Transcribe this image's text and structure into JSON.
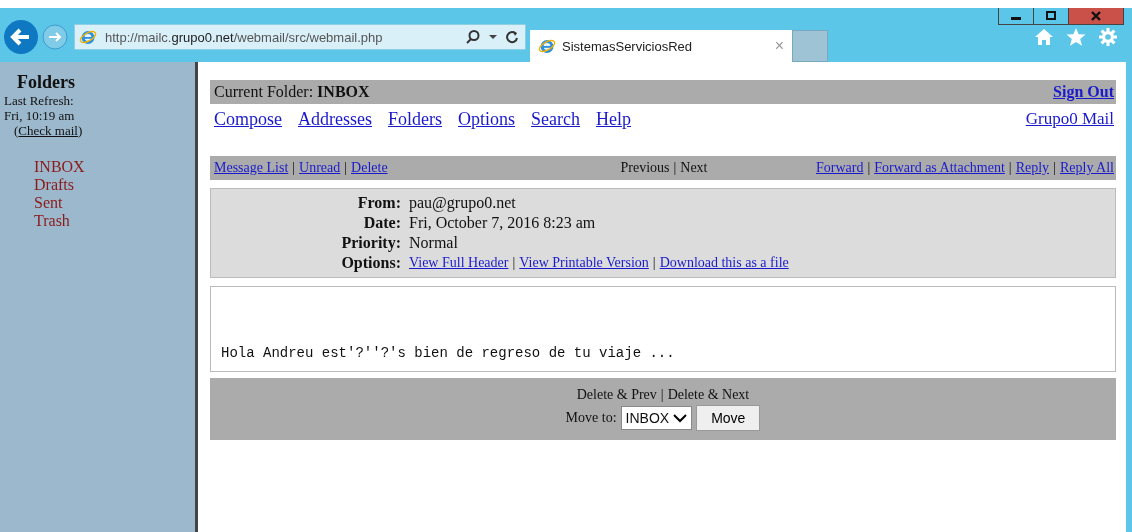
{
  "browser": {
    "url": "http://mailc.**grupo0.net**/webmail/src/webmail.php",
    "tab_title": "SistemasServiciosRed",
    "tab_close": "×"
  },
  "sidebar": {
    "title": "Folders",
    "refresh_label": "Last Refresh:",
    "refresh_time": "Fri, 10:19 am",
    "check_open": "(",
    "check_link": "Check mail",
    "check_close": ")",
    "folders": [
      "INBOX",
      "Drafts",
      "Sent",
      "Trash"
    ]
  },
  "header": {
    "label": "Current Folder:",
    "folder": "INBOX",
    "sign_out": "Sign Out"
  },
  "nav": {
    "links": [
      "Compose",
      "Addresses",
      "Folders",
      "Options",
      "Search",
      "Help"
    ],
    "brand": "Grupo0 Mail"
  },
  "toolbar": {
    "separator": "|",
    "left": [
      "Message List",
      "Unread",
      "Delete"
    ],
    "center": [
      "Previous",
      "Next"
    ],
    "right": [
      "Forward",
      "Forward as Attachment",
      "Reply",
      "Reply All"
    ]
  },
  "message": {
    "fields": [
      {
        "label": "From:",
        "value": "pau@grupo0.net"
      },
      {
        "label": "Date:",
        "value": "Fri, October 7, 2016 8:23 am"
      },
      {
        "label": "Priority:",
        "value": "Normal"
      }
    ],
    "options_label": "Options:",
    "options": [
      "View Full Header",
      "View Printable Version",
      "Download this as a file"
    ],
    "body": "Hola Andreu est'?''?'s bien de regreso de tu viaje ..."
  },
  "footer": {
    "actions": [
      "Delete & Prev",
      "Delete & Next"
    ],
    "move_label": "Move to:",
    "move_value": "INBOX",
    "move_button": "Move"
  }
}
